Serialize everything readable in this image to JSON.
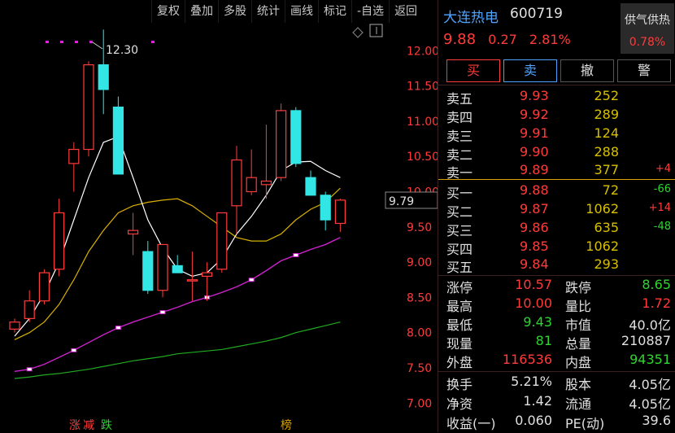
{
  "toolbar": {
    "items": [
      "复权",
      "叠加",
      "多股",
      "统计",
      "画线",
      "标记",
      "-自选",
      "返回"
    ]
  },
  "chart": {
    "y_ticks": [
      "12.00",
      "11.50",
      "11.00",
      "10.50",
      "10.00",
      "9.50",
      "9.00",
      "8.50",
      "8.00",
      "7.50",
      "7.00"
    ],
    "high_label": "12.30",
    "current_price_tag": "9.79",
    "bottom_tags": {
      "a": "涨",
      "b": "减",
      "c": "跌",
      "d": "榜"
    }
  },
  "chart_data": {
    "type": "candlestick",
    "ylim": [
      6.75,
      12.55
    ],
    "candles": [
      {
        "o": 8.05,
        "h": 8.2,
        "l": 8.0,
        "c": 8.15,
        "up": true
      },
      {
        "o": 8.2,
        "h": 8.6,
        "l": 8.15,
        "c": 8.45,
        "up": true
      },
      {
        "o": 8.45,
        "h": 8.9,
        "l": 8.4,
        "c": 8.85,
        "up": true
      },
      {
        "o": 8.9,
        "h": 9.9,
        "l": 8.8,
        "c": 9.7,
        "up": true
      },
      {
        "o": 10.4,
        "h": 10.7,
        "l": 10.0,
        "c": 10.6,
        "up": true
      },
      {
        "o": 10.6,
        "h": 11.85,
        "l": 10.5,
        "c": 11.8,
        "up": true
      },
      {
        "o": 11.8,
        "h": 12.3,
        "l": 11.1,
        "c": 11.45,
        "down": true
      },
      {
        "o": 11.2,
        "h": 11.35,
        "l": 10.25,
        "c": 10.25,
        "down": true
      },
      {
        "o": 9.45,
        "h": 9.7,
        "l": 9.1,
        "c": 9.4,
        "up": true
      },
      {
        "o": 9.15,
        "h": 9.3,
        "l": 8.55,
        "c": 8.6,
        "down": true
      },
      {
        "o": 8.6,
        "h": 9.25,
        "l": 8.5,
        "c": 9.25,
        "up": true
      },
      {
        "o": 8.95,
        "h": 9.1,
        "l": 8.85,
        "c": 8.85,
        "down": true
      },
      {
        "o": 8.75,
        "h": 9.15,
        "l": 8.45,
        "c": 8.75,
        "up": true
      },
      {
        "o": 8.8,
        "h": 9.0,
        "l": 8.45,
        "c": 8.85,
        "up": true
      },
      {
        "o": 8.9,
        "h": 9.7,
        "l": 8.85,
        "c": 9.7,
        "up": true
      },
      {
        "o": 9.8,
        "h": 10.65,
        "l": 9.4,
        "c": 10.45,
        "up": true
      },
      {
        "o": 10.0,
        "h": 10.6,
        "l": 9.95,
        "c": 10.2,
        "up": true
      },
      {
        "o": 10.1,
        "h": 10.95,
        "l": 9.9,
        "c": 10.15,
        "up": true
      },
      {
        "o": 10.2,
        "h": 11.25,
        "l": 10.15,
        "c": 11.15,
        "up": true
      },
      {
        "o": 11.15,
        "h": 11.2,
        "l": 10.35,
        "c": 10.4,
        "down": true
      },
      {
        "o": 10.2,
        "h": 10.3,
        "l": 9.95,
        "c": 9.95,
        "down": true
      },
      {
        "o": 9.95,
        "h": 10.0,
        "l": 9.45,
        "c": 9.6,
        "down": true
      },
      {
        "o": 9.55,
        "h": 9.9,
        "l": 9.43,
        "c": 9.88,
        "up": true
      }
    ],
    "ma_white": [
      7.95,
      8.2,
      8.55,
      9.0,
      9.6,
      10.2,
      10.7,
      10.78,
      10.2,
      9.6,
      9.2,
      8.9,
      8.8,
      8.85,
      9.05,
      9.4,
      9.65,
      9.95,
      10.3,
      10.42,
      10.43,
      10.3,
      10.2
    ],
    "ma_yellow": [
      7.9,
      8.0,
      8.15,
      8.4,
      8.75,
      9.15,
      9.45,
      9.7,
      9.8,
      9.85,
      9.88,
      9.9,
      9.8,
      9.65,
      9.5,
      9.35,
      9.3,
      9.3,
      9.4,
      9.6,
      9.75,
      9.85,
      10.05
    ],
    "ma_purple": [
      7.45,
      7.48,
      7.55,
      7.65,
      7.75,
      7.86,
      7.97,
      8.07,
      8.15,
      8.22,
      8.29,
      8.36,
      8.44,
      8.5,
      8.57,
      8.65,
      8.75,
      8.88,
      9.02,
      9.1,
      9.18,
      9.25,
      9.35
    ],
    "ma_green": [
      7.35,
      7.37,
      7.4,
      7.42,
      7.45,
      7.48,
      7.52,
      7.56,
      7.6,
      7.63,
      7.66,
      7.7,
      7.72,
      7.74,
      7.76,
      7.8,
      7.84,
      7.88,
      7.93,
      8.0,
      8.05,
      8.1,
      8.15
    ]
  },
  "quote": {
    "name": "大连热电",
    "code": "600719",
    "price": "9.88",
    "change": "0.27",
    "change_pct": "2.81%",
    "gq_title": "供气供热",
    "gq_value": "0.78%"
  },
  "actions": {
    "buy": "买",
    "sell": "卖",
    "cancel": "撤",
    "alert": "警"
  },
  "order_book": {
    "asks": [
      {
        "label": "卖五",
        "price": "9.93",
        "vol": "252",
        "chg": ""
      },
      {
        "label": "卖四",
        "price": "9.92",
        "vol": "289",
        "chg": ""
      },
      {
        "label": "卖三",
        "price": "9.91",
        "vol": "124",
        "chg": ""
      },
      {
        "label": "卖二",
        "price": "9.90",
        "vol": "288",
        "chg": ""
      },
      {
        "label": "卖一",
        "price": "9.89",
        "vol": "377",
        "chg": "+4"
      }
    ],
    "bids": [
      {
        "label": "买一",
        "price": "9.88",
        "vol": "72",
        "chg": "-66"
      },
      {
        "label": "买二",
        "price": "9.87",
        "vol": "1062",
        "chg": "+14"
      },
      {
        "label": "买三",
        "price": "9.86",
        "vol": "635",
        "chg": "-48"
      },
      {
        "label": "买四",
        "price": "9.85",
        "vol": "1062",
        "chg": ""
      },
      {
        "label": "买五",
        "price": "9.84",
        "vol": "293",
        "chg": ""
      }
    ]
  },
  "stats": {
    "rows1": [
      {
        "l1": "涨停",
        "v1": "10.57",
        "l2": "跌停",
        "v2": "8.65"
      },
      {
        "l1": "最高",
        "v1": "10.00",
        "l2": "量比",
        "v2": "1.72"
      },
      {
        "l1": "最低",
        "v1": "9.43",
        "l2": "市值",
        "v2": "40.0亿"
      },
      {
        "l1": "现量",
        "v1": "81",
        "l2": "总量",
        "v2": "210887"
      },
      {
        "l1": "外盘",
        "v1": "116536",
        "l2": "内盘",
        "v2": "94351"
      }
    ],
    "rows2": [
      {
        "l1": "换手",
        "v1": "5.21%",
        "l2": "股本",
        "v2": "4.05亿"
      },
      {
        "l1": "净资",
        "v1": "1.42",
        "l2": "流通",
        "v2": "4.05亿"
      },
      {
        "l1": "收益(一)",
        "v1": "0.060",
        "l2": "PE(动)",
        "v2": "39.6"
      }
    ]
  },
  "colors": {
    "up": "#ff3b3b",
    "down": "#33e6e6",
    "ma1": "#ffffff",
    "ma2": "#d8b000",
    "ma3": "#cc22cc",
    "ma4": "#22aa22"
  }
}
